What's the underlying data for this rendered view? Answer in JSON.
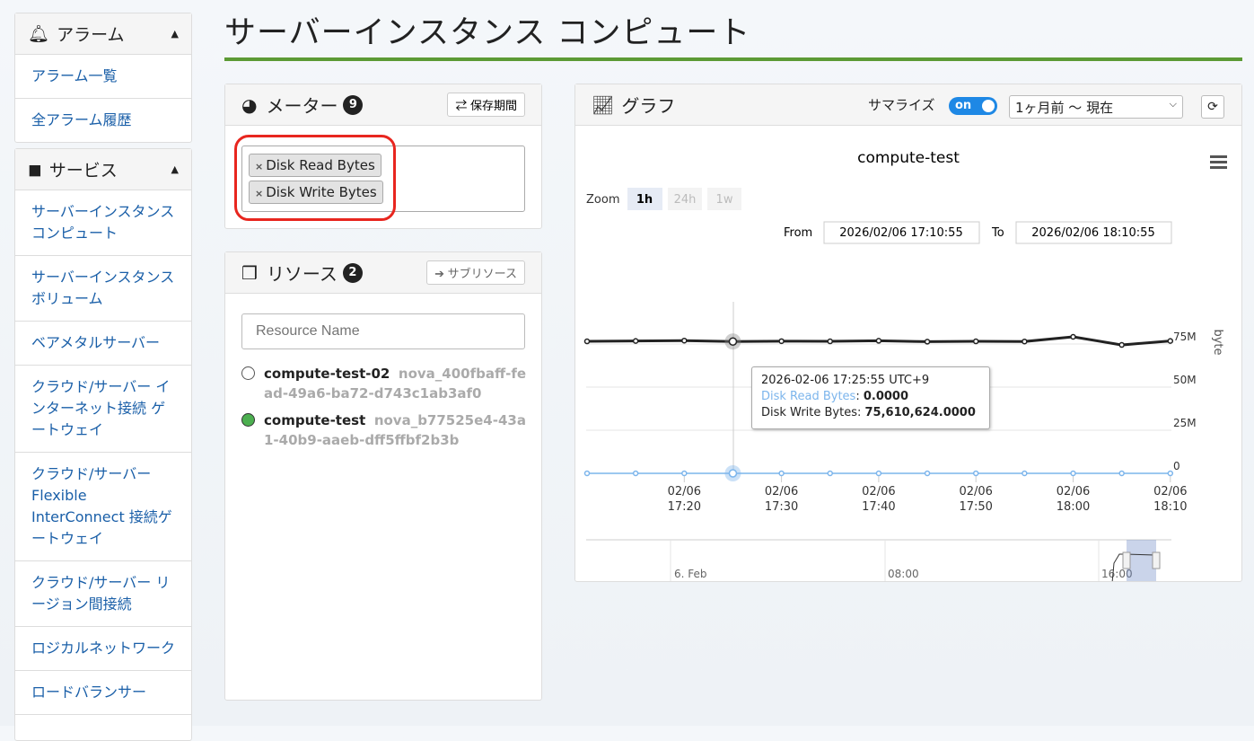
{
  "sidebar": {
    "alarm": {
      "title": "アラーム",
      "items": [
        "アラーム一覧",
        "全アラーム履歴"
      ]
    },
    "service": {
      "title": "サービス",
      "items": [
        "サーバーインスタンス コンピュート",
        "サーバーインスタンス ボリューム",
        "ベアメタルサーバー",
        "クラウド/サーバー インターネット接続 ゲートウェイ",
        "クラウド/サーバー Flexible InterConnect 接続ゲートウェイ",
        "クラウド/サーバー リージョン間接続",
        "ロジカルネットワーク",
        "ロードバランサー"
      ]
    }
  },
  "page_title": "サーバーインスタンス コンピュート",
  "meter": {
    "title": "メーター",
    "count": "9",
    "retention_button": "保存期間",
    "tags": [
      "Disk Read Bytes",
      "Disk Write Bytes"
    ],
    "remove_glyph": "×"
  },
  "resource": {
    "title": "リソース",
    "count": "2",
    "sub_button": "サブリソース",
    "search_placeholder": "Resource Name",
    "items": [
      {
        "name": "compute-test-02",
        "id": "nova_400fbaff-fead-49a6-ba72-d743c1ab3af0",
        "selected": false
      },
      {
        "name": "compute-test",
        "id": "nova_b77525e4-43a1-40b9-aaeb-dff5ffbf2b3b",
        "selected": true
      }
    ]
  },
  "graph": {
    "title": "グラフ",
    "summarize_label": "サマライズ",
    "toggle": "on",
    "period": "1ヶ月前 〜 現在",
    "zoom_label": "Zoom",
    "zoom_options": [
      "1h",
      "24h",
      "1w"
    ],
    "from_label": "From",
    "from": "2026/02/06 17:10:55",
    "to_label": "To",
    "to": "2026/02/06 18:10:55",
    "tooltip": {
      "time": "2026-02-06 17:25:55 UTC+9",
      "read_label": "Disk Read Bytes",
      "read_value": "0.0000",
      "write_label": "Disk Write Bytes",
      "write_value": "75,610,624.0000"
    },
    "navigator_labels": [
      "6. Feb",
      "08:00",
      "16:00"
    ]
  },
  "chart_data": {
    "type": "line",
    "title": "compute-test",
    "ylabel": "byte",
    "ylim": [
      0,
      75000000
    ],
    "yticks": [
      "0",
      "25M",
      "50M",
      "75M"
    ],
    "xticks": [
      {
        "d": "02/06",
        "t": "17:20"
      },
      {
        "d": "02/06",
        "t": "17:30"
      },
      {
        "d": "02/06",
        "t": "17:40"
      },
      {
        "d": "02/06",
        "t": "17:50"
      },
      {
        "d": "02/06",
        "t": "18:00"
      },
      {
        "d": "02/06",
        "t": "18:10"
      }
    ],
    "x_minutes_from_1710": [
      1,
      6,
      11,
      16,
      21,
      26,
      31,
      36,
      41,
      46,
      51,
      56,
      61
    ],
    "series": [
      {
        "name": "Disk Read Bytes",
        "color": "#7cb5ec",
        "values": [
          0,
          0,
          0,
          0,
          0,
          0,
          0,
          0,
          0,
          0,
          0,
          0,
          0
        ]
      },
      {
        "name": "Disk Write Bytes",
        "color": "#222222",
        "values": [
          73000000,
          73200000,
          73400000,
          72900000,
          73100000,
          73000000,
          73300000,
          72800000,
          73000000,
          72900000,
          75500000,
          71000000,
          73200000
        ]
      }
    ]
  }
}
